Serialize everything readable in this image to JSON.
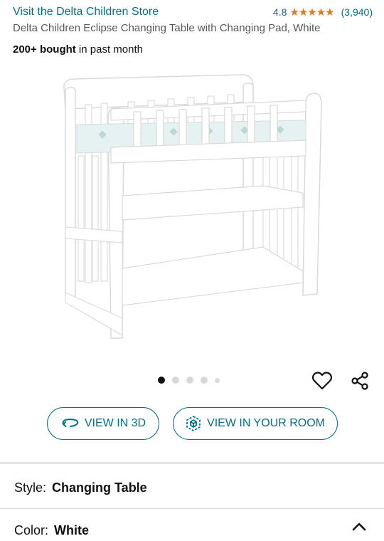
{
  "header": {
    "store_link": "Visit the Delta Children Store",
    "rating": "4.8",
    "stars": "★★★★★",
    "rating_count": "(3,940)"
  },
  "product": {
    "title": "Delta Children Eclipse Changing Table with Changing Pad, White",
    "bought_bold": "200+ bought",
    "bought_rest": " in past month",
    "image_icon": "changing-table-image"
  },
  "gallery": {
    "total_dots": 5,
    "active_index": 0
  },
  "actions": {
    "view_3d": "VIEW IN 3D",
    "view_room": "VIEW IN YOUR ROOM"
  },
  "options": {
    "style_label": "Style:",
    "style_value": "Changing Table",
    "color_label": "Color:",
    "color_value": "White"
  },
  "colors": {
    "link": "#007185",
    "star": "#de7921",
    "text": "#0f1111",
    "muted": "#565959"
  }
}
